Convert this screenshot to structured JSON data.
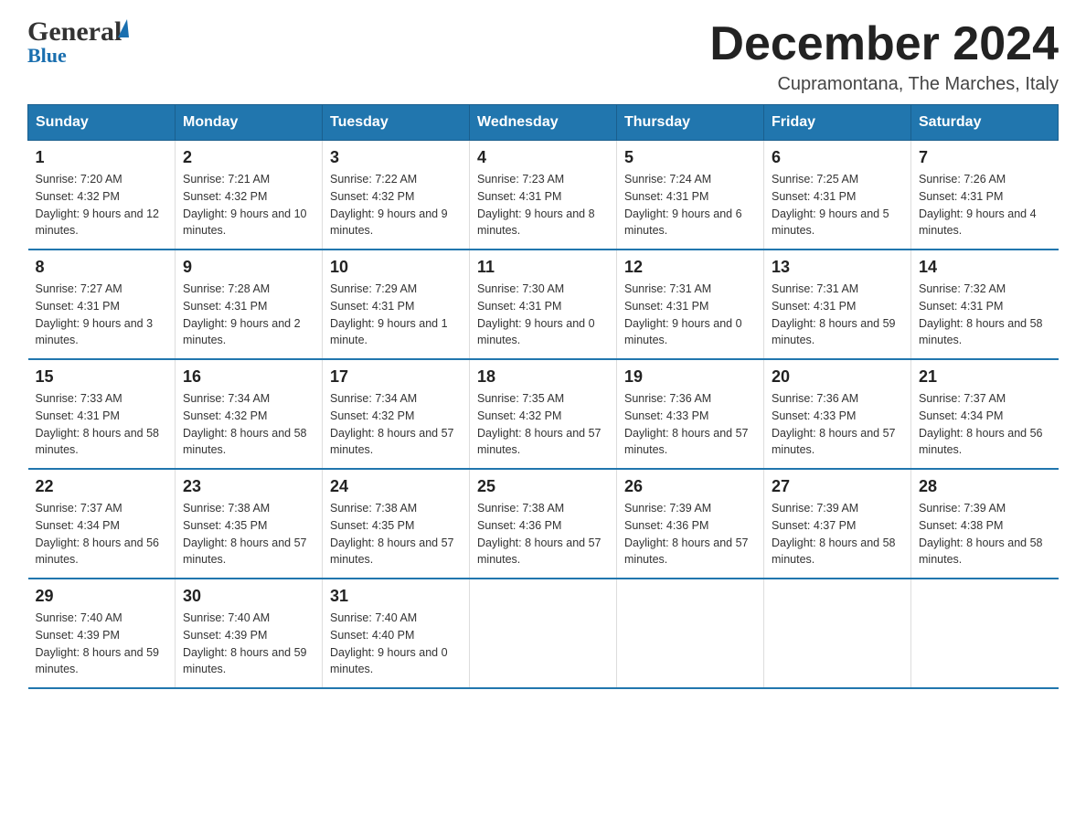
{
  "header": {
    "logo": {
      "general": "General",
      "blue": "Blue"
    },
    "title": "December 2024",
    "location": "Cupramontana, The Marches, Italy"
  },
  "calendar": {
    "days_of_week": [
      "Sunday",
      "Monday",
      "Tuesday",
      "Wednesday",
      "Thursday",
      "Friday",
      "Saturday"
    ],
    "weeks": [
      [
        {
          "day": "1",
          "sunrise": "7:20 AM",
          "sunset": "4:32 PM",
          "daylight": "9 hours and 12 minutes."
        },
        {
          "day": "2",
          "sunrise": "7:21 AM",
          "sunset": "4:32 PM",
          "daylight": "9 hours and 10 minutes."
        },
        {
          "day": "3",
          "sunrise": "7:22 AM",
          "sunset": "4:32 PM",
          "daylight": "9 hours and 9 minutes."
        },
        {
          "day": "4",
          "sunrise": "7:23 AM",
          "sunset": "4:31 PM",
          "daylight": "9 hours and 8 minutes."
        },
        {
          "day": "5",
          "sunrise": "7:24 AM",
          "sunset": "4:31 PM",
          "daylight": "9 hours and 6 minutes."
        },
        {
          "day": "6",
          "sunrise": "7:25 AM",
          "sunset": "4:31 PM",
          "daylight": "9 hours and 5 minutes."
        },
        {
          "day": "7",
          "sunrise": "7:26 AM",
          "sunset": "4:31 PM",
          "daylight": "9 hours and 4 minutes."
        }
      ],
      [
        {
          "day": "8",
          "sunrise": "7:27 AM",
          "sunset": "4:31 PM",
          "daylight": "9 hours and 3 minutes."
        },
        {
          "day": "9",
          "sunrise": "7:28 AM",
          "sunset": "4:31 PM",
          "daylight": "9 hours and 2 minutes."
        },
        {
          "day": "10",
          "sunrise": "7:29 AM",
          "sunset": "4:31 PM",
          "daylight": "9 hours and 1 minute."
        },
        {
          "day": "11",
          "sunrise": "7:30 AM",
          "sunset": "4:31 PM",
          "daylight": "9 hours and 0 minutes."
        },
        {
          "day": "12",
          "sunrise": "7:31 AM",
          "sunset": "4:31 PM",
          "daylight": "9 hours and 0 minutes."
        },
        {
          "day": "13",
          "sunrise": "7:31 AM",
          "sunset": "4:31 PM",
          "daylight": "8 hours and 59 minutes."
        },
        {
          "day": "14",
          "sunrise": "7:32 AM",
          "sunset": "4:31 PM",
          "daylight": "8 hours and 58 minutes."
        }
      ],
      [
        {
          "day": "15",
          "sunrise": "7:33 AM",
          "sunset": "4:31 PM",
          "daylight": "8 hours and 58 minutes."
        },
        {
          "day": "16",
          "sunrise": "7:34 AM",
          "sunset": "4:32 PM",
          "daylight": "8 hours and 58 minutes."
        },
        {
          "day": "17",
          "sunrise": "7:34 AM",
          "sunset": "4:32 PM",
          "daylight": "8 hours and 57 minutes."
        },
        {
          "day": "18",
          "sunrise": "7:35 AM",
          "sunset": "4:32 PM",
          "daylight": "8 hours and 57 minutes."
        },
        {
          "day": "19",
          "sunrise": "7:36 AM",
          "sunset": "4:33 PM",
          "daylight": "8 hours and 57 minutes."
        },
        {
          "day": "20",
          "sunrise": "7:36 AM",
          "sunset": "4:33 PM",
          "daylight": "8 hours and 57 minutes."
        },
        {
          "day": "21",
          "sunrise": "7:37 AM",
          "sunset": "4:34 PM",
          "daylight": "8 hours and 56 minutes."
        }
      ],
      [
        {
          "day": "22",
          "sunrise": "7:37 AM",
          "sunset": "4:34 PM",
          "daylight": "8 hours and 56 minutes."
        },
        {
          "day": "23",
          "sunrise": "7:38 AM",
          "sunset": "4:35 PM",
          "daylight": "8 hours and 57 minutes."
        },
        {
          "day": "24",
          "sunrise": "7:38 AM",
          "sunset": "4:35 PM",
          "daylight": "8 hours and 57 minutes."
        },
        {
          "day": "25",
          "sunrise": "7:38 AM",
          "sunset": "4:36 PM",
          "daylight": "8 hours and 57 minutes."
        },
        {
          "day": "26",
          "sunrise": "7:39 AM",
          "sunset": "4:36 PM",
          "daylight": "8 hours and 57 minutes."
        },
        {
          "day": "27",
          "sunrise": "7:39 AM",
          "sunset": "4:37 PM",
          "daylight": "8 hours and 58 minutes."
        },
        {
          "day": "28",
          "sunrise": "7:39 AM",
          "sunset": "4:38 PM",
          "daylight": "8 hours and 58 minutes."
        }
      ],
      [
        {
          "day": "29",
          "sunrise": "7:40 AM",
          "sunset": "4:39 PM",
          "daylight": "8 hours and 59 minutes."
        },
        {
          "day": "30",
          "sunrise": "7:40 AM",
          "sunset": "4:39 PM",
          "daylight": "8 hours and 59 minutes."
        },
        {
          "day": "31",
          "sunrise": "7:40 AM",
          "sunset": "4:40 PM",
          "daylight": "9 hours and 0 minutes."
        },
        null,
        null,
        null,
        null
      ]
    ],
    "labels": {
      "sunrise": "Sunrise:",
      "sunset": "Sunset:",
      "daylight": "Daylight:"
    }
  }
}
